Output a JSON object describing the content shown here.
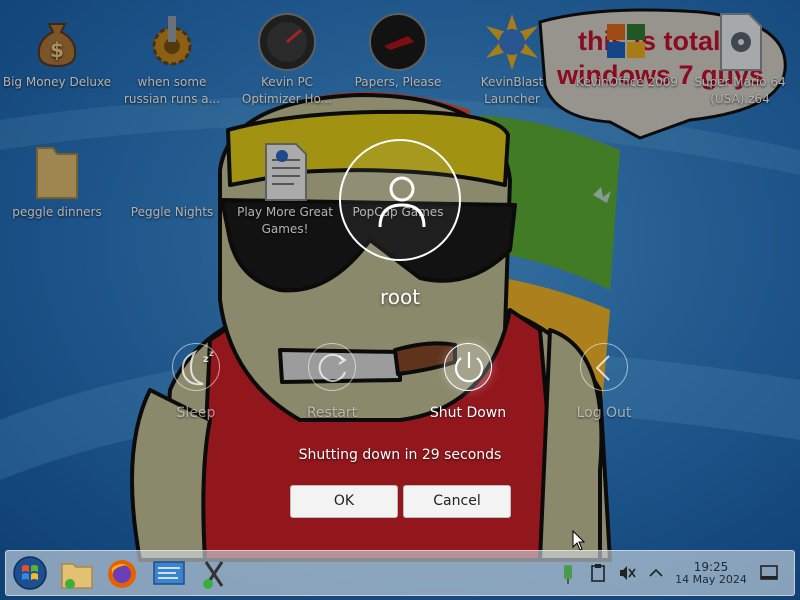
{
  "desktop": {
    "icons": [
      {
        "name": "big-money-deluxe",
        "label": "Big Money Deluxe",
        "icon": "money-bag-icon"
      },
      {
        "name": "russian-runs",
        "label": "when some russian runs a...",
        "icon": "gear-icon"
      },
      {
        "name": "kevin-pc-optimizer",
        "label": "Kevin PC Optimizer Ho...",
        "icon": "gauge-icon"
      },
      {
        "name": "papers-please",
        "label": "Papers, Please",
        "icon": "papers-please-icon"
      },
      {
        "name": "kevinblast-launcher",
        "label": "KevinBlast Launcher",
        "icon": "burst-icon"
      },
      {
        "name": "kevinoffice-2009",
        "label": "KevinOffice 2009",
        "icon": "office-icon"
      },
      {
        "name": "super-mario-64",
        "label": "Super Mario 64 (USA).z64",
        "icon": "disc-file-icon"
      },
      {
        "name": "peggle-dinners",
        "label": "peggle dinners",
        "icon": "folder-icon"
      },
      {
        "name": "peggle-nights",
        "label": "Peggle Nights",
        "icon": "peggle-icon"
      },
      {
        "name": "play-more-great-games",
        "label": "Play More Great Games!",
        "icon": "document-icon"
      },
      {
        "name": "popcap-games",
        "label": "PopCap Games",
        "icon": "popcap-icon"
      }
    ],
    "speech_bubble": "this is totally windows 7 guys"
  },
  "logout_screen": {
    "username": "root",
    "actions": [
      {
        "id": "sleep",
        "label": "Sleep",
        "icon": "sleep-moon-icon"
      },
      {
        "id": "restart",
        "label": "Restart",
        "icon": "restart-icon"
      },
      {
        "id": "shutdown",
        "label": "Shut Down",
        "icon": "power-icon",
        "active": true
      },
      {
        "id": "logout",
        "label": "Log Out",
        "icon": "logout-arrow-icon"
      }
    ],
    "countdown": "Shutting down in 29 seconds",
    "ok_label": "OK",
    "cancel_label": "Cancel"
  },
  "taskbar": {
    "apps": [
      "start-orb-icon",
      "file-manager-icon",
      "firefox-icon",
      "kate-editor-icon",
      "xfce-app-icon"
    ],
    "tray": [
      "network-icon",
      "clipboard-icon",
      "volume-muted-icon",
      "chevron-up-icon"
    ],
    "clock_time": "19:25",
    "clock_date": "14 May 2024",
    "show_desktop": "show-desktop-icon"
  },
  "colors": {
    "desktop_blue": "#2a78c4",
    "wallpaper_green": "#5fb037",
    "dialog_button_bg": "#f3f3f3",
    "taskbar_bg": "#d2dce4"
  }
}
